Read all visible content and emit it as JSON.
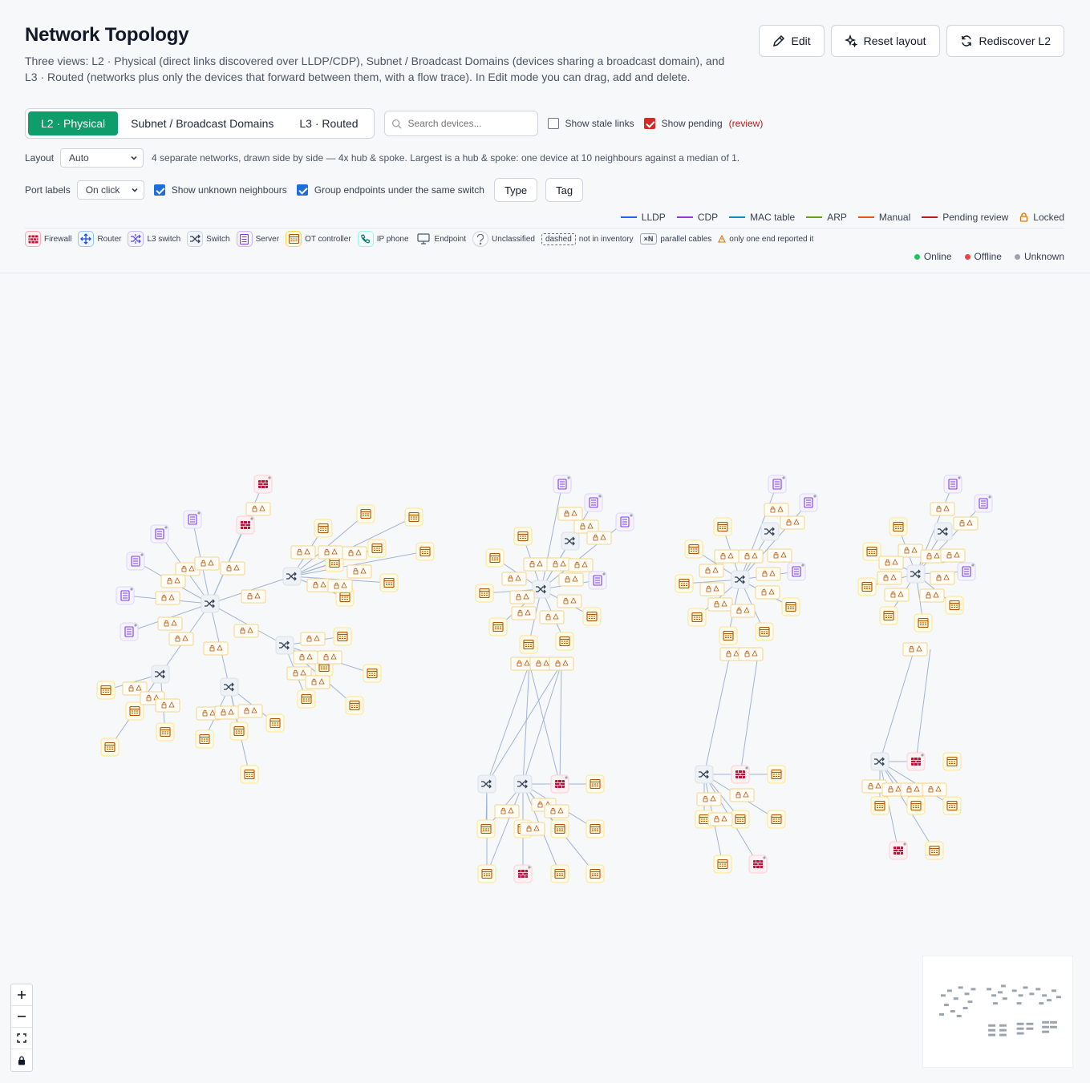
{
  "header": {
    "title": "Network Topology",
    "description": "Three views: L2 · Physical (direct links discovered over LLDP/CDP), Subnet / Broadcast Domains (devices sharing a broadcast domain), and L3 · Routed (networks plus only the devices that forward between them, with a flow trace). In Edit mode you can drag, add and delete."
  },
  "actions": {
    "edit": "Edit",
    "reset": "Reset layout",
    "rediscover": "Rediscover L2"
  },
  "views": {
    "l2": "L2 · Physical",
    "subnet": "Subnet / Broadcast Domains",
    "l3": "L3 · Routed",
    "active": "l2"
  },
  "search": {
    "placeholder": "Search devices..."
  },
  "toggles": {
    "stale": "Show stale links",
    "pending": "Show pending",
    "review": "(review)"
  },
  "layout": {
    "label": "Layout",
    "value": "Auto",
    "info": "4 separate networks, drawn side by side — 4x hub & spoke. Largest is a hub & spoke: one device at 10 neighbours against a median of 1."
  },
  "ports": {
    "label": "Port labels",
    "value": "On click",
    "unknown": "Show unknown neighbours",
    "group": "Group endpoints under the same switch",
    "type_btn": "Type",
    "tag_btn": "Tag"
  },
  "edge_legend": {
    "lldp": "LLDP",
    "cdp": "CDP",
    "mac": "MAC table",
    "arp": "ARP",
    "manual": "Manual",
    "pending": "Pending review",
    "locked": "Locked",
    "colors": {
      "lldp": "#2563eb",
      "cdp": "#9333ea",
      "mac": "#0891b2",
      "arp": "#65a30d",
      "manual": "#ea580c",
      "pending": "#b91c1c"
    }
  },
  "type_legend": {
    "firewall": "Firewall",
    "router": "Router",
    "l3switch": "L3 switch",
    "switch": "Switch",
    "server": "Server",
    "ot": "OT controller",
    "phone": "IP phone",
    "endpoint": "Endpoint",
    "unclassified": "Unclassified",
    "dashed": "dashed",
    "not_inventory": "not in inventory",
    "xn": "×N",
    "parallel": "parallel cables",
    "one_end": "only one end reported it"
  },
  "status_legend": {
    "online": "Online",
    "offline": "Offline",
    "unknown": "Unknown",
    "colors": {
      "online": "#22c55e",
      "offline": "#ef4444",
      "unknown": "#9ca3af"
    }
  },
  "colors": {
    "accent": "#0f9d6b",
    "firewall": "#be123c",
    "server": "#8b5cf6",
    "ot": "#d97706",
    "switch": "#334155"
  }
}
